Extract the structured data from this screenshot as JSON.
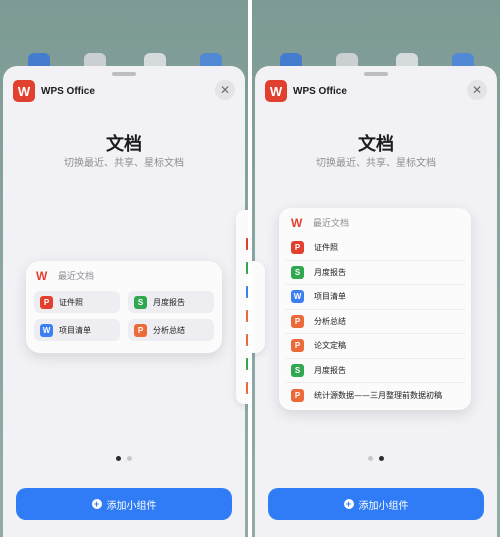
{
  "colors": {
    "wallpaper": "#87a4a0",
    "accent_blue": "#2f7cf6",
    "wps_red": "#e2402e",
    "sheet_bg": "#f2f2f6",
    "pdf_red": "#e2402e",
    "sheet_green": "#2fa84f",
    "word_blue": "#3b7ff3",
    "ppt_orange": "#ec6a3a"
  },
  "home_icons": [
    {
      "icon": "photos-app-icon",
      "color": "#3a78d8"
    },
    {
      "icon": "notes-app-icon",
      "color": "#d7d9dc"
    },
    {
      "icon": "text-app-icon",
      "color": "#e4e5e7"
    },
    {
      "icon": "keynote-app-icon",
      "color": "#4a86de"
    }
  ],
  "left": {
    "app_name": "WPS Office",
    "logo_glyph": "W",
    "close_glyph": "✕",
    "title": "文档",
    "subtitle": "切换最近、共享、星标文档",
    "widget": {
      "header": "最近文档",
      "items": [
        {
          "label": "证件照",
          "icon": "pdf-icon",
          "glyph": "P",
          "color": "#e2402e"
        },
        {
          "label": "月度报告",
          "icon": "spreadsheet-icon",
          "glyph": "S",
          "color": "#2fa84f"
        },
        {
          "label": "项目清单",
          "icon": "word-doc-icon",
          "glyph": "W",
          "color": "#3b7ff3"
        },
        {
          "label": "分析总结",
          "icon": "presentation-icon",
          "glyph": "P",
          "color": "#ec6a3a"
        }
      ]
    },
    "peek_icons": [
      {
        "icon": "pdf-icon",
        "color": "#e2402e"
      },
      {
        "icon": "spreadsheet-icon",
        "color": "#2fa84f"
      },
      {
        "icon": "word-doc-icon",
        "color": "#3b7ff3"
      },
      {
        "icon": "presentation-icon",
        "color": "#ec6a3a"
      },
      {
        "icon": "presentation-icon",
        "color": "#ec6a3a"
      },
      {
        "icon": "spreadsheet-icon",
        "color": "#2fa84f"
      },
      {
        "icon": "presentation-icon",
        "color": "#ec6a3a"
      }
    ],
    "active_page": 0,
    "add_button": "添加小组件",
    "plus_glyph": "+"
  },
  "right": {
    "app_name": "WPS Office",
    "logo_glyph": "W",
    "close_glyph": "✕",
    "title": "文档",
    "subtitle": "切换最近、共享、星标文档",
    "widget": {
      "header": "最近文档",
      "items": [
        {
          "label": "证件照",
          "icon": "pdf-icon",
          "glyph": "P",
          "color": "#e2402e"
        },
        {
          "label": "月度报告",
          "icon": "spreadsheet-icon",
          "glyph": "S",
          "color": "#2fa84f"
        },
        {
          "label": "项目清单",
          "icon": "word-doc-icon",
          "glyph": "W",
          "color": "#3b7ff3"
        },
        {
          "label": "分析总结",
          "icon": "presentation-icon",
          "glyph": "P",
          "color": "#ec6a3a"
        },
        {
          "label": "论文定稿",
          "icon": "presentation-icon",
          "glyph": "P",
          "color": "#ec6a3a"
        },
        {
          "label": "月度报告",
          "icon": "spreadsheet-icon",
          "glyph": "S",
          "color": "#2fa84f"
        },
        {
          "label": "统计源数据——三月整理前数据初稿",
          "icon": "presentation-icon",
          "glyph": "P",
          "color": "#ec6a3a"
        }
      ]
    },
    "active_page": 1,
    "add_button": "添加小组件",
    "plus_glyph": "+"
  }
}
